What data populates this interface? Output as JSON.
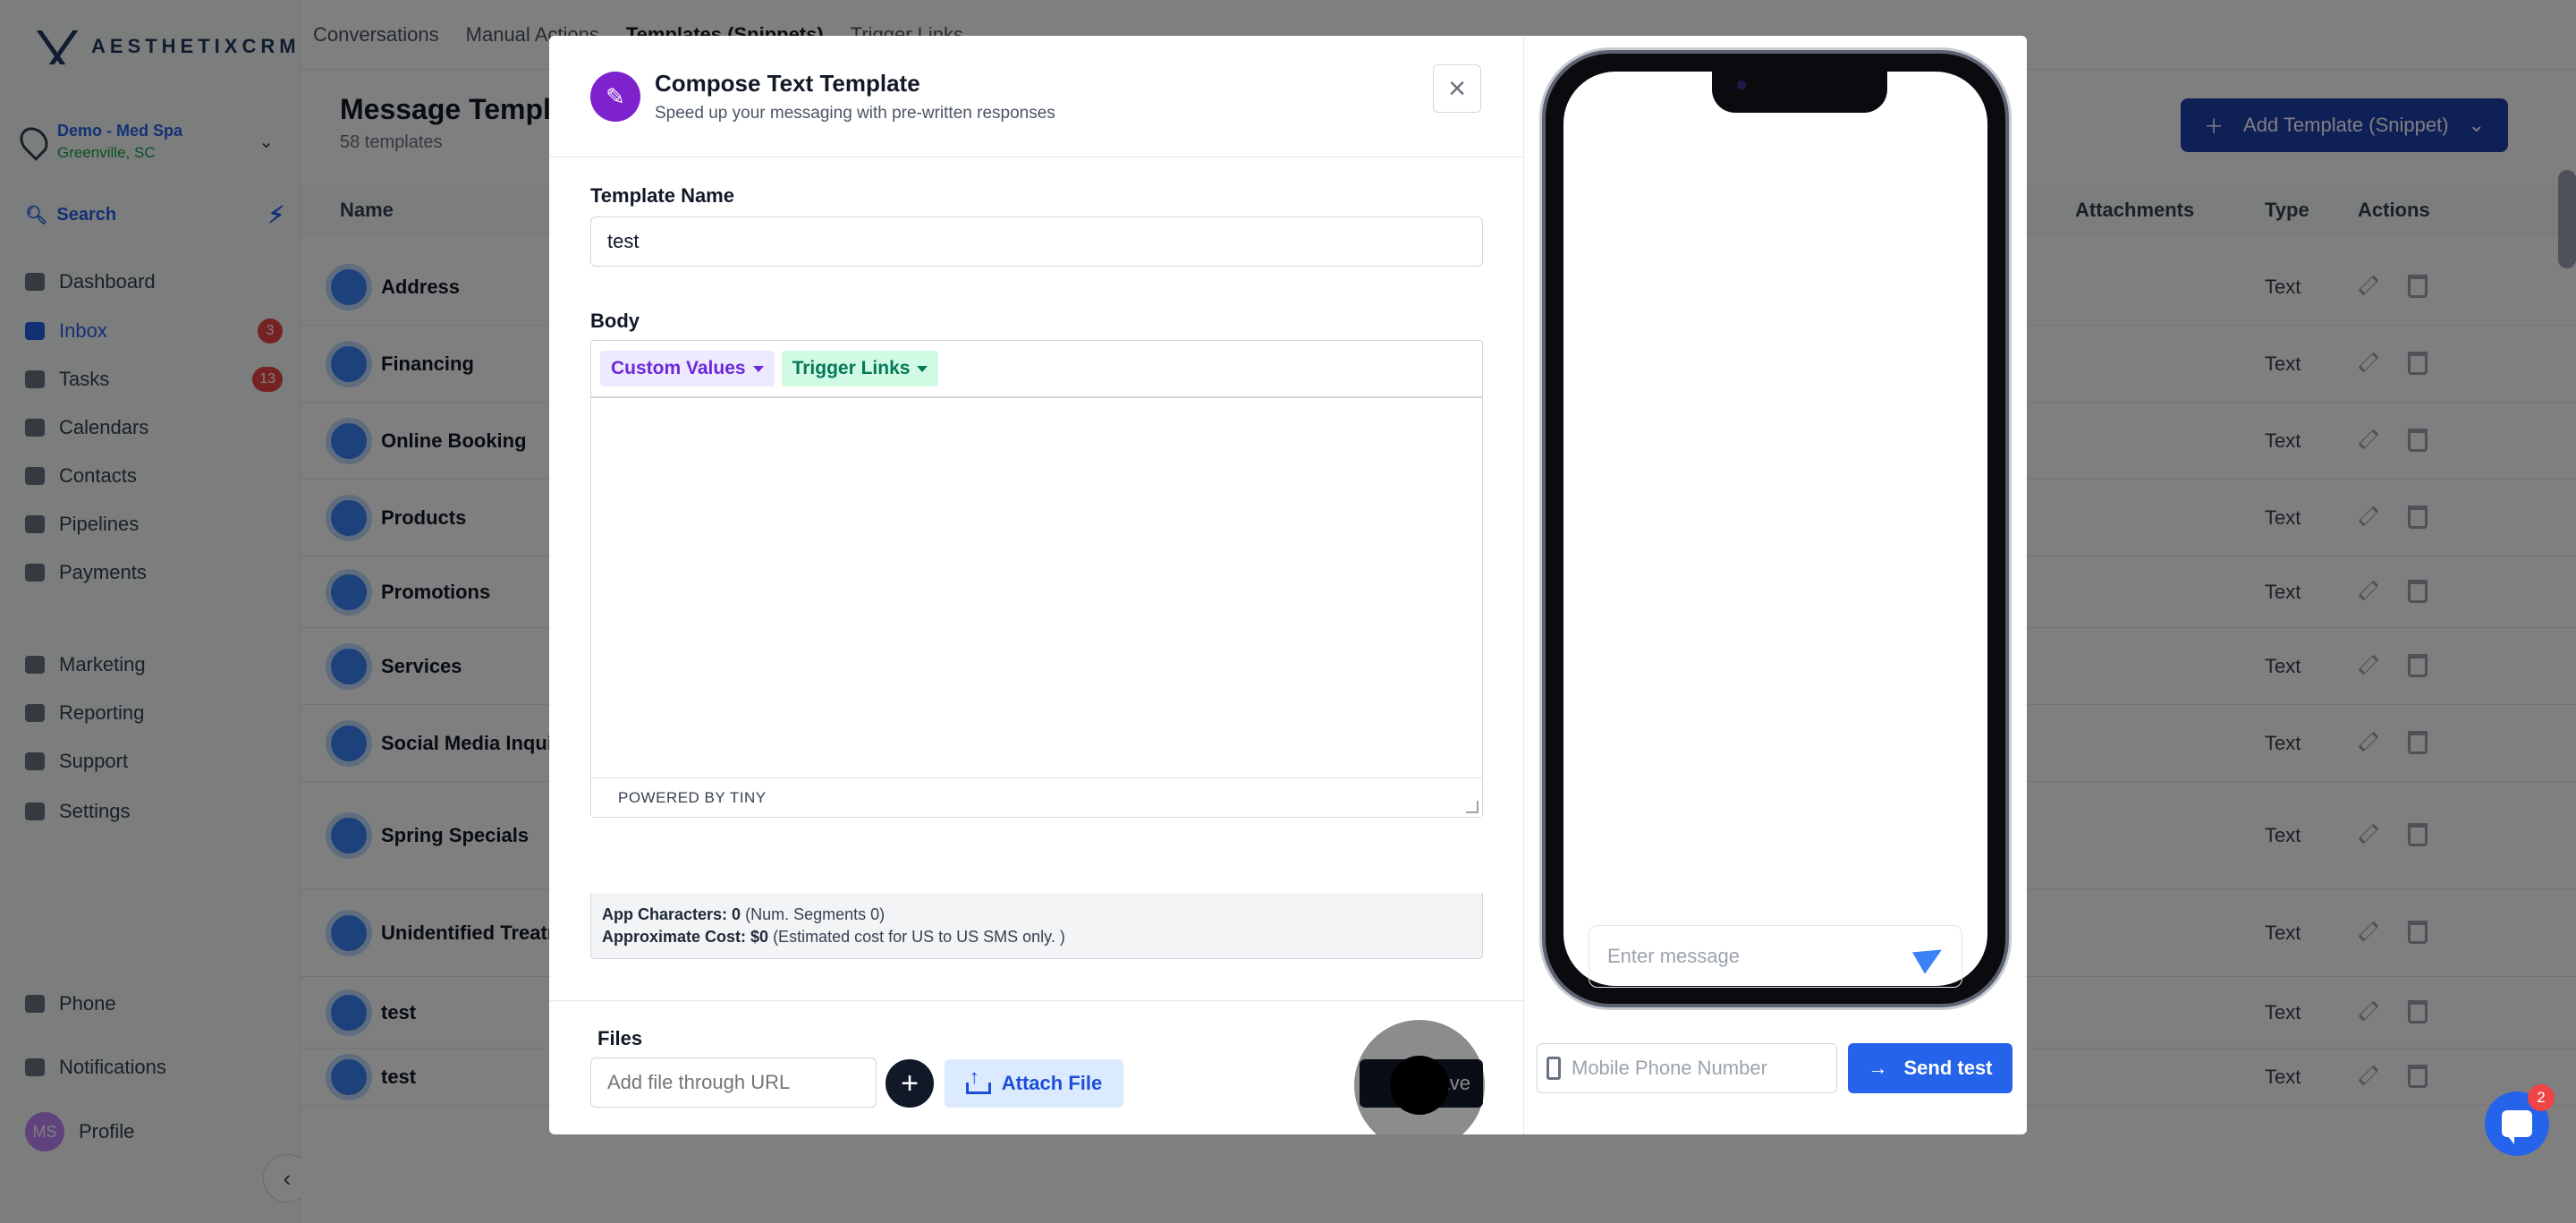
{
  "app": {
    "brand": "AESTHETIXCRM",
    "location": {
      "name": "Demo - Med Spa",
      "sub": "Greenville, SC"
    },
    "search_label": "Search",
    "nav": [
      {
        "label": "Dashboard"
      },
      {
        "label": "Inbox",
        "badge": "3"
      },
      {
        "label": "Tasks",
        "badge": "13"
      },
      {
        "label": "Calendars"
      },
      {
        "label": "Contacts"
      },
      {
        "label": "Pipelines"
      },
      {
        "label": "Payments"
      },
      {
        "label": "Marketing"
      },
      {
        "label": "Reporting"
      },
      {
        "label": "Support"
      },
      {
        "label": "Settings"
      }
    ],
    "bottom_nav": {
      "phone": "Phone",
      "notifications": "Notifications",
      "profile": "Profile",
      "profile_initials": "MS"
    },
    "tabs": [
      "Conversations",
      "Manual Actions",
      "Templates (Snippets)",
      "Trigger Links"
    ],
    "page_title": "Message Templates",
    "page_sub": "58 templates",
    "add_button": "Add Template (Snippet)",
    "table": {
      "headers": {
        "name": "Name",
        "attachments": "Attachments",
        "type": "Type",
        "actions": "Actions"
      },
      "rows": [
        {
          "name": "Address",
          "type": "Text"
        },
        {
          "name": "Financing",
          "type": "Text"
        },
        {
          "name": "Online Booking",
          "type": "Text"
        },
        {
          "name": "Products",
          "type": "Text"
        },
        {
          "name": "Promotions",
          "type": "Text"
        },
        {
          "name": "Services",
          "type": "Text"
        },
        {
          "name": "Social Media Inquiry",
          "type": "Text"
        },
        {
          "name": "Spring Specials",
          "type": "Text"
        },
        {
          "name": "Unidentified Treatment",
          "type": "Text"
        },
        {
          "name": "test",
          "type": "Text"
        },
        {
          "name": "test",
          "type": "Text"
        }
      ]
    }
  },
  "modal": {
    "title": "Compose Text Template",
    "subtitle": "Speed up your messaging with pre-written responses",
    "template_name_label": "Template Name",
    "template_name_value": "test",
    "body_label": "Body",
    "custom_values": "Custom Values",
    "trigger_links": "Trigger Links",
    "powered_by": "POWERED BY TINY",
    "app_chars_label": "App Characters: 0",
    "app_chars_note": "(Num. Segments 0)",
    "cost_label": "Approximate Cost: $0",
    "cost_note": "(Estimated cost for US to US SMS only. )",
    "files_label": "Files",
    "file_url_placeholder": "Add file through URL",
    "attach_file": "Attach File",
    "save": "Save",
    "preview": {
      "message_placeholder": "Enter message",
      "mobile_placeholder": "Mobile Phone Number",
      "send_test": "Send test"
    }
  },
  "chat_badge": "2",
  "colors": {
    "primary": "#2563eb",
    "purple": "#7e22ce",
    "dark": "#111827"
  }
}
